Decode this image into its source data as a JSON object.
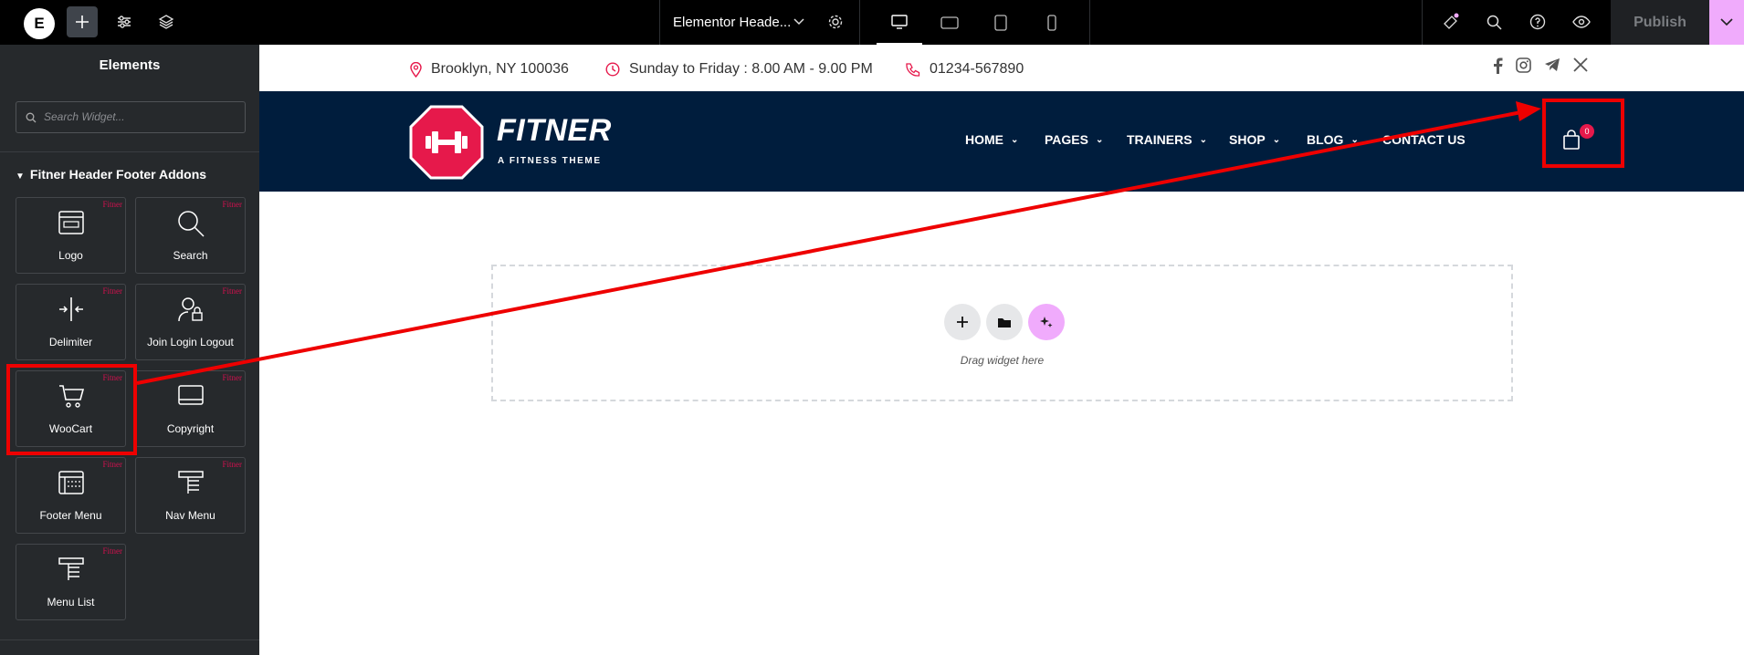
{
  "topbar": {
    "logo_letter": "E",
    "doc_title": "Elementor Heade...",
    "publish_label": "Publish"
  },
  "sidebar": {
    "title": "Elements",
    "search_placeholder": "Search Widget...",
    "category": "Fitner Header Footer Addons",
    "badge": "Fitner",
    "widgets": [
      {
        "label": "Logo",
        "icon": "logo-icon"
      },
      {
        "label": "Search",
        "icon": "search-icon"
      },
      {
        "label": "Delimiter",
        "icon": "delimiter-icon"
      },
      {
        "label": "Join Login Logout",
        "icon": "user-lock-icon"
      },
      {
        "label": "WooCart",
        "icon": "cart-icon"
      },
      {
        "label": "Copyright",
        "icon": "copyright-icon"
      },
      {
        "label": "Footer Menu",
        "icon": "footer-menu-icon"
      },
      {
        "label": "Nav Menu",
        "icon": "nav-menu-icon"
      },
      {
        "label": "Menu List",
        "icon": "menu-list-icon"
      }
    ]
  },
  "header": {
    "address": "Brooklyn, NY 100036",
    "hours": "Sunday to Friday : 8.00 AM - 9.00 PM",
    "phone": "01234-567890",
    "brand_name": "FITNER",
    "brand_tagline": "A FITNESS THEME",
    "nav": [
      "HOME",
      "PAGES",
      "TRAINERS",
      "SHOP",
      "BLOG",
      "CONTACT US"
    ],
    "cart_count": "0"
  },
  "canvas": {
    "drop_text": "Drag widget here"
  },
  "colors": {
    "accent": "#e6194b",
    "navbar": "#001d3d",
    "highlight": "#ee0000",
    "ai_button": "#f0abfc"
  }
}
